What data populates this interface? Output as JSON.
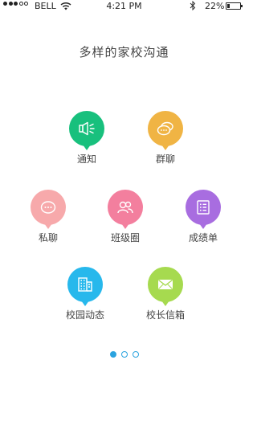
{
  "status_bar": {
    "signal_bars_filled": 3,
    "signal_bars_total": 5,
    "carrier": "BELL",
    "time": "4:21 PM",
    "battery_percent": "22%",
    "battery_level": 0.22,
    "icons": [
      "wifi-icon",
      "bluetooth-icon",
      "battery-icon"
    ]
  },
  "page": {
    "title": "多样的家校沟通"
  },
  "features": [
    {
      "label": "通知",
      "icon": "megaphone-icon",
      "color": "#18c07d"
    },
    {
      "label": "群聊",
      "icon": "chat-bubbles-icon",
      "color": "#f0b444"
    },
    {
      "label": "私聊",
      "icon": "chat-dots-icon",
      "color": "#f7a9ab"
    },
    {
      "label": "班级圈",
      "icon": "people-icon",
      "color": "#f37f9e"
    },
    {
      "label": "成绩单",
      "icon": "list-icon",
      "color": "#a86de0"
    },
    {
      "label": "校园动态",
      "icon": "building-icon",
      "color": "#27b8ec"
    },
    {
      "label": "校长信箱",
      "icon": "envelope-icon",
      "color": "#a6da4f"
    }
  ],
  "pager": {
    "pages": 3,
    "current": 1
  }
}
